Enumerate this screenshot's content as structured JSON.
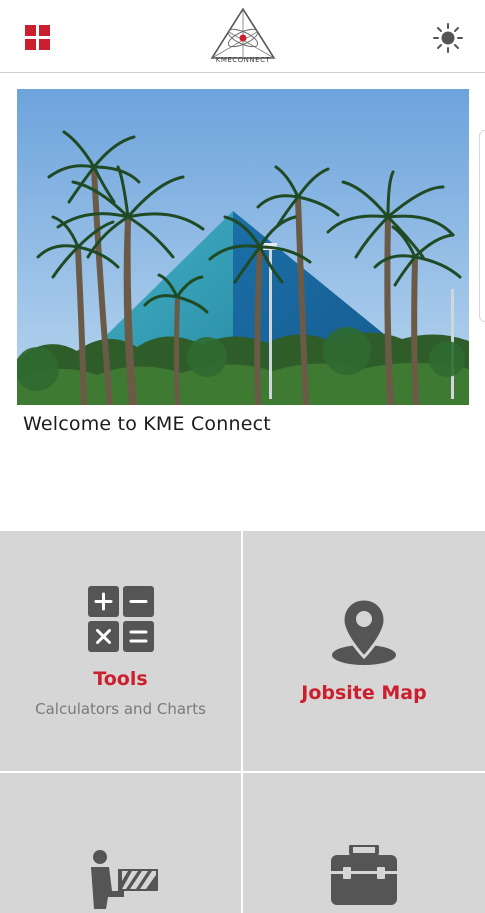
{
  "header": {
    "menu_icon": "grid-menu-icon",
    "logo_icon": "kme-connect-logo",
    "logo_text": "KMECONNECT",
    "theme_icon": "sun-icon",
    "accent_color": "#cc1f2e"
  },
  "hero": {
    "image_icon": "pyramid-palms-photo"
  },
  "welcome": {
    "text": "Welcome to KME Connect"
  },
  "tiles": [
    {
      "title": "Tools",
      "subtitle": "Calculators and Charts",
      "icon": "calculator-icon"
    },
    {
      "title": "Jobsite Map",
      "icon": "map-pin-icon"
    },
    {
      "title": "",
      "icon": "worker-barrier-icon"
    },
    {
      "title": "",
      "icon": "toolbox-icon"
    }
  ]
}
